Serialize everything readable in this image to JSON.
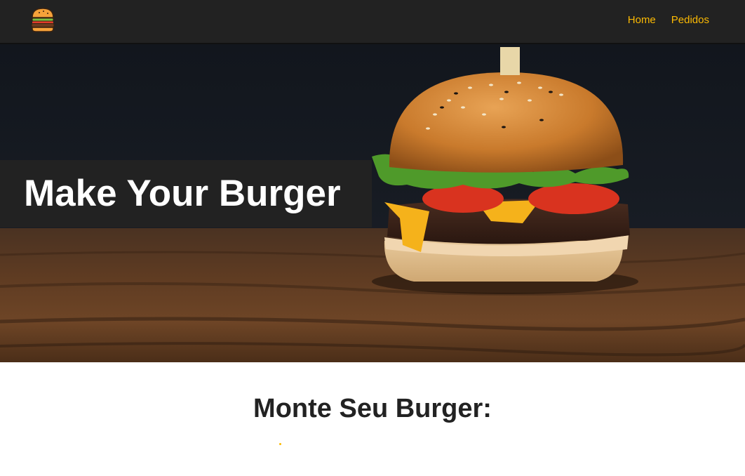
{
  "colors": {
    "nav_background": "#222222",
    "accent": "#fcba03",
    "hero_title_background": "#222222",
    "hero_title_text": "#ffffff",
    "heading_text": "#222222"
  },
  "nav": {
    "logo_icon": "burger-logo-icon",
    "links": [
      {
        "label": "Home"
      },
      {
        "label": "Pedidos"
      }
    ]
  },
  "hero": {
    "image": "burger-photo",
    "title": "Make Your Burger"
  },
  "main": {
    "heading": "Monte Seu Burger:"
  }
}
